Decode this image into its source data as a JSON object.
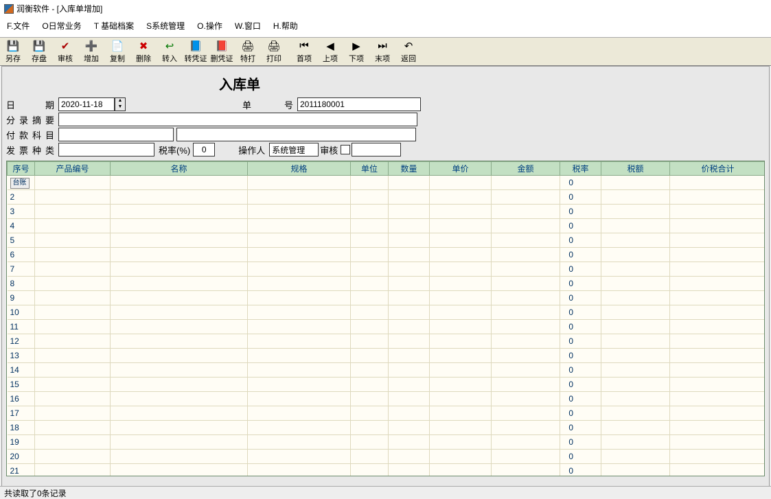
{
  "window": {
    "title": "润衡软件 - [入库单增加]"
  },
  "menu": [
    "F.文件",
    "O日常业务",
    "T 基础档案",
    "S系统管理",
    "O.操作",
    "W.窗口",
    "H.帮助"
  ],
  "toolbar": [
    {
      "label": "另存",
      "icon": "💾",
      "name": "save-as-button"
    },
    {
      "label": "存盘",
      "icon": "💾",
      "name": "save-button"
    },
    {
      "label": "审核",
      "icon": "✔",
      "name": "audit-button",
      "color": "#a00"
    },
    {
      "label": "增加",
      "icon": "➕",
      "name": "add-button",
      "color": "#06c"
    },
    {
      "label": "复制",
      "icon": "📄",
      "name": "copy-button"
    },
    {
      "label": "删除",
      "icon": "✖",
      "name": "delete-button",
      "color": "#c00"
    },
    {
      "label": "转入",
      "icon": "↩",
      "name": "import-button",
      "color": "#070"
    },
    {
      "label": "转凭证",
      "icon": "📘",
      "name": "voucher-button"
    },
    {
      "label": "删凭证",
      "icon": "📕",
      "name": "del-voucher-button"
    },
    {
      "label": "特打",
      "icon": "🖨",
      "name": "special-print-button"
    },
    {
      "label": "打印",
      "icon": "🖨",
      "name": "print-button"
    },
    {
      "label": "首项",
      "icon": "⏮",
      "name": "first-button"
    },
    {
      "label": "上项",
      "icon": "◀",
      "name": "prev-button"
    },
    {
      "label": "下项",
      "icon": "▶",
      "name": "next-button"
    },
    {
      "label": "末项",
      "icon": "⏭",
      "name": "last-button"
    },
    {
      "label": "返回",
      "icon": "↶",
      "name": "back-button"
    }
  ],
  "doc": {
    "title": "入库单",
    "labels": {
      "date": "日　期",
      "docno": "单　　号",
      "summary": "分录摘要",
      "account": "付款科目",
      "invoice": "发票种类",
      "taxrate": "税率(%)",
      "operator": "操作人",
      "audit": "审核"
    },
    "date": "2020-11-18",
    "docno": "2011180001",
    "summary": "",
    "account1": "",
    "account2": "",
    "invoice": "",
    "taxrate": "0",
    "operator": "系统管理",
    "audit": ""
  },
  "grid": {
    "columns": [
      "序号",
      "产品编号",
      "名称",
      "规格",
      "单位",
      "数量",
      "单价",
      "金额",
      "税率",
      "税额",
      "价税合计"
    ],
    "widths": [
      40,
      110,
      200,
      150,
      55,
      60,
      90,
      100,
      60,
      100,
      140
    ],
    "rows": 21,
    "row1_btn": "台账",
    "default_rate": "0"
  },
  "status": {
    "left": "共读取了0条记录"
  }
}
